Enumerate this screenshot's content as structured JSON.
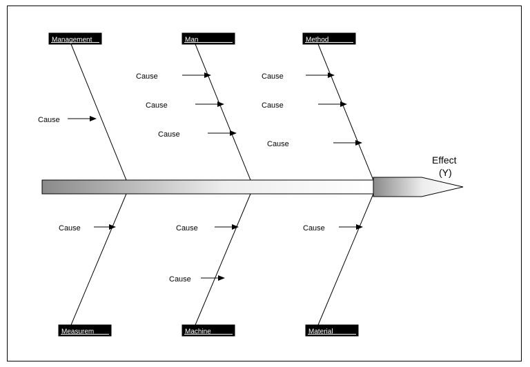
{
  "effect": {
    "label1": "Effect",
    "label2": "(Y)"
  },
  "categories": {
    "top": [
      {
        "id": "management",
        "label": "Management"
      },
      {
        "id": "man",
        "label": "Man"
      },
      {
        "id": "method",
        "label": "Method"
      }
    ],
    "bottom": [
      {
        "id": "measurement",
        "label": "Measurem"
      },
      {
        "id": "machine",
        "label": "Machine"
      },
      {
        "id": "material",
        "label": "Material"
      }
    ]
  },
  "cause_word": "Cause",
  "causes": {
    "management": [
      "Cause"
    ],
    "man": [
      "Cause",
      "Cause",
      "Cause"
    ],
    "method": [
      "Cause",
      "Cause",
      "Cause"
    ],
    "measurement": [
      "Cause"
    ],
    "machine": [
      "Cause",
      "Cause"
    ],
    "material": [
      "Cause"
    ]
  }
}
